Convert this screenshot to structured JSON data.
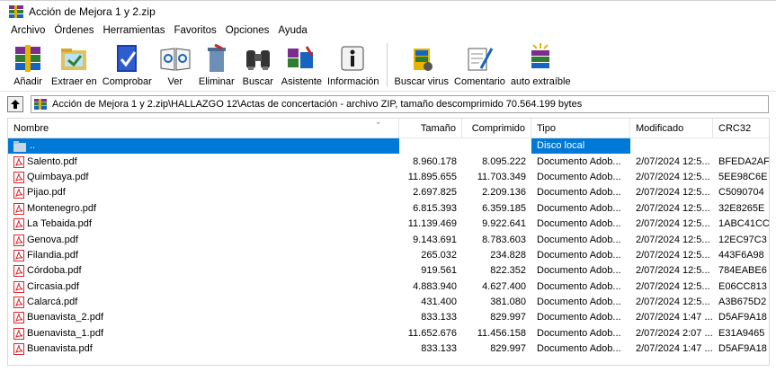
{
  "window": {
    "title": "Acción de Mejora 1 y 2.zip",
    "icon": "winrar-books-icon"
  },
  "menu": [
    "Archivo",
    "Órdenes",
    "Herramientas",
    "Favoritos",
    "Opciones",
    "Ayuda"
  ],
  "toolbar": [
    {
      "label": "Añadir",
      "icon": "add-archive-icon"
    },
    {
      "label": "Extraer en",
      "icon": "extract-to-icon"
    },
    {
      "label": "Comprobar",
      "icon": "test-archive-icon"
    },
    {
      "label": "Ver",
      "icon": "view-book-icon"
    },
    {
      "label": "Eliminar",
      "icon": "delete-icon"
    },
    {
      "label": "Buscar",
      "icon": "binoculars-icon"
    },
    {
      "label": "Asistente",
      "icon": "wizard-icon"
    },
    {
      "label": "Información",
      "icon": "info-icon"
    },
    {
      "label": "Buscar virus",
      "icon": "virus-scan-icon"
    },
    {
      "label": "Comentario",
      "icon": "comment-icon"
    },
    {
      "label": "auto extraíble",
      "icon": "sfx-icon"
    }
  ],
  "path": {
    "text": "Acción de Mejora 1 y 2.zip\\HALLAZGO 12\\Actas de concertación - archivo ZIP, tamaño descomprimido 70.564.199 bytes"
  },
  "columns": {
    "name": "Nombre",
    "size": "Tamaño",
    "packed": "Comprimido",
    "type": "Tipo",
    "modified": "Modificado",
    "crc": "CRC32"
  },
  "parent_row": {
    "name": "..",
    "type": "Disco local"
  },
  "files": [
    {
      "name": "Salento.pdf",
      "size": "8.960.178",
      "packed": "8.095.222",
      "type": "Documento Adob...",
      "modified": "2/07/2024 12:5...",
      "crc": "BFEDA2AF"
    },
    {
      "name": "Quimbaya.pdf",
      "size": "11.895.655",
      "packed": "11.703.349",
      "type": "Documento Adob...",
      "modified": "2/07/2024 12:5...",
      "crc": "5EE98C6E"
    },
    {
      "name": "Pijao.pdf",
      "size": "2.697.825",
      "packed": "2.209.136",
      "type": "Documento Adob...",
      "modified": "2/07/2024 12:5...",
      "crc": "C5090704"
    },
    {
      "name": "Montenegro.pdf",
      "size": "6.815.393",
      "packed": "6.359.185",
      "type": "Documento Adob...",
      "modified": "2/07/2024 12:5...",
      "crc": "32E8265E"
    },
    {
      "name": "La Tebaida.pdf",
      "size": "11.139.469",
      "packed": "9.922.641",
      "type": "Documento Adob...",
      "modified": "2/07/2024 12:5...",
      "crc": "1ABC41CC"
    },
    {
      "name": "Genova.pdf",
      "size": "9.143.691",
      "packed": "8.783.603",
      "type": "Documento Adob...",
      "modified": "2/07/2024 12:5...",
      "crc": "12EC97C3"
    },
    {
      "name": "Filandia.pdf",
      "size": "265.032",
      "packed": "234.828",
      "type": "Documento Adob...",
      "modified": "2/07/2024 12:5...",
      "crc": "443F6A98"
    },
    {
      "name": "Córdoba.pdf",
      "size": "919.561",
      "packed": "822.352",
      "type": "Documento Adob...",
      "modified": "2/07/2024 12:5...",
      "crc": "784EABE6"
    },
    {
      "name": "Circasia.pdf",
      "size": "4.883.940",
      "packed": "4.627.400",
      "type": "Documento Adob...",
      "modified": "2/07/2024 12:5...",
      "crc": "E06CC813"
    },
    {
      "name": "Calarcá.pdf",
      "size": "431.400",
      "packed": "381.080",
      "type": "Documento Adob...",
      "modified": "2/07/2024 12:5...",
      "crc": "A3B675D2"
    },
    {
      "name": "Buenavista_2.pdf",
      "size": "833.133",
      "packed": "829.997",
      "type": "Documento Adob...",
      "modified": "2/07/2024 1:47 ...",
      "crc": "D5AF9A18"
    },
    {
      "name": "Buenavista_1.pdf",
      "size": "11.652.676",
      "packed": "11.456.158",
      "type": "Documento Adob...",
      "modified": "2/07/2024 2:07 ...",
      "crc": "E31A9465"
    },
    {
      "name": "Buenavista.pdf",
      "size": "833.133",
      "packed": "829.997",
      "type": "Documento Adob...",
      "modified": "2/07/2024 1:47 ...",
      "crc": "D5AF9A18"
    }
  ],
  "colors": {
    "selection": "#0078d7",
    "pdf_red": "#d8262c"
  }
}
